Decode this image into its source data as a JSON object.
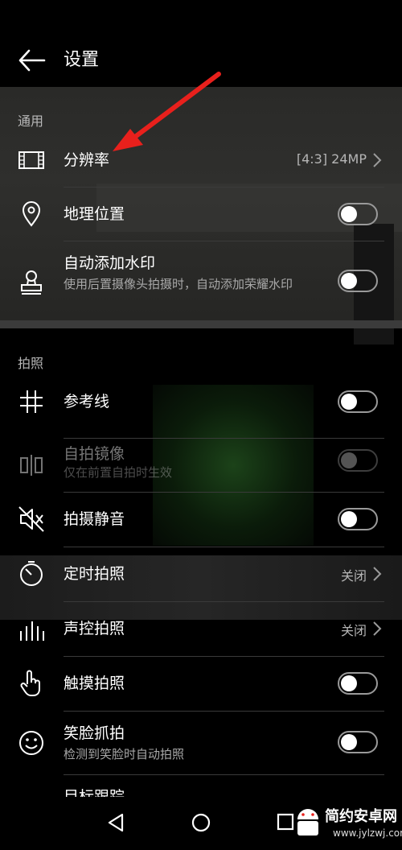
{
  "header": {
    "title": "设置"
  },
  "sections": {
    "general": "通用",
    "photo": "拍照"
  },
  "rows": {
    "resolution": {
      "label": "分辨率",
      "value": "[4:3] 24MP"
    },
    "location": {
      "label": "地理位置",
      "on": false
    },
    "watermark": {
      "label": "自动添加水印",
      "sub": "使用后置摄像头拍摄时，自动添加荣耀水印",
      "on": false
    },
    "grid": {
      "label": "参考线",
      "on": false
    },
    "mirror": {
      "label": "自拍镜像",
      "sub": "仅在前置自拍时生效",
      "on": false,
      "disabled": true
    },
    "mute": {
      "label": "拍摄静音",
      "on": false
    },
    "timer": {
      "label": "定时拍照",
      "value": "关闭"
    },
    "voice": {
      "label": "声控拍照",
      "value": "关闭"
    },
    "touch": {
      "label": "触摸拍照",
      "on": false
    },
    "smile": {
      "label": "笑脸抓拍",
      "sub": "检测到笑脸时自动拍照",
      "on": false
    },
    "tracking": {
      "label": "目标跟踪"
    }
  },
  "annotation": {
    "arrow_color": "#e8201c"
  },
  "watermark_logo": {
    "text": "简约安卓网",
    "url": "www.jylzwj.com"
  }
}
